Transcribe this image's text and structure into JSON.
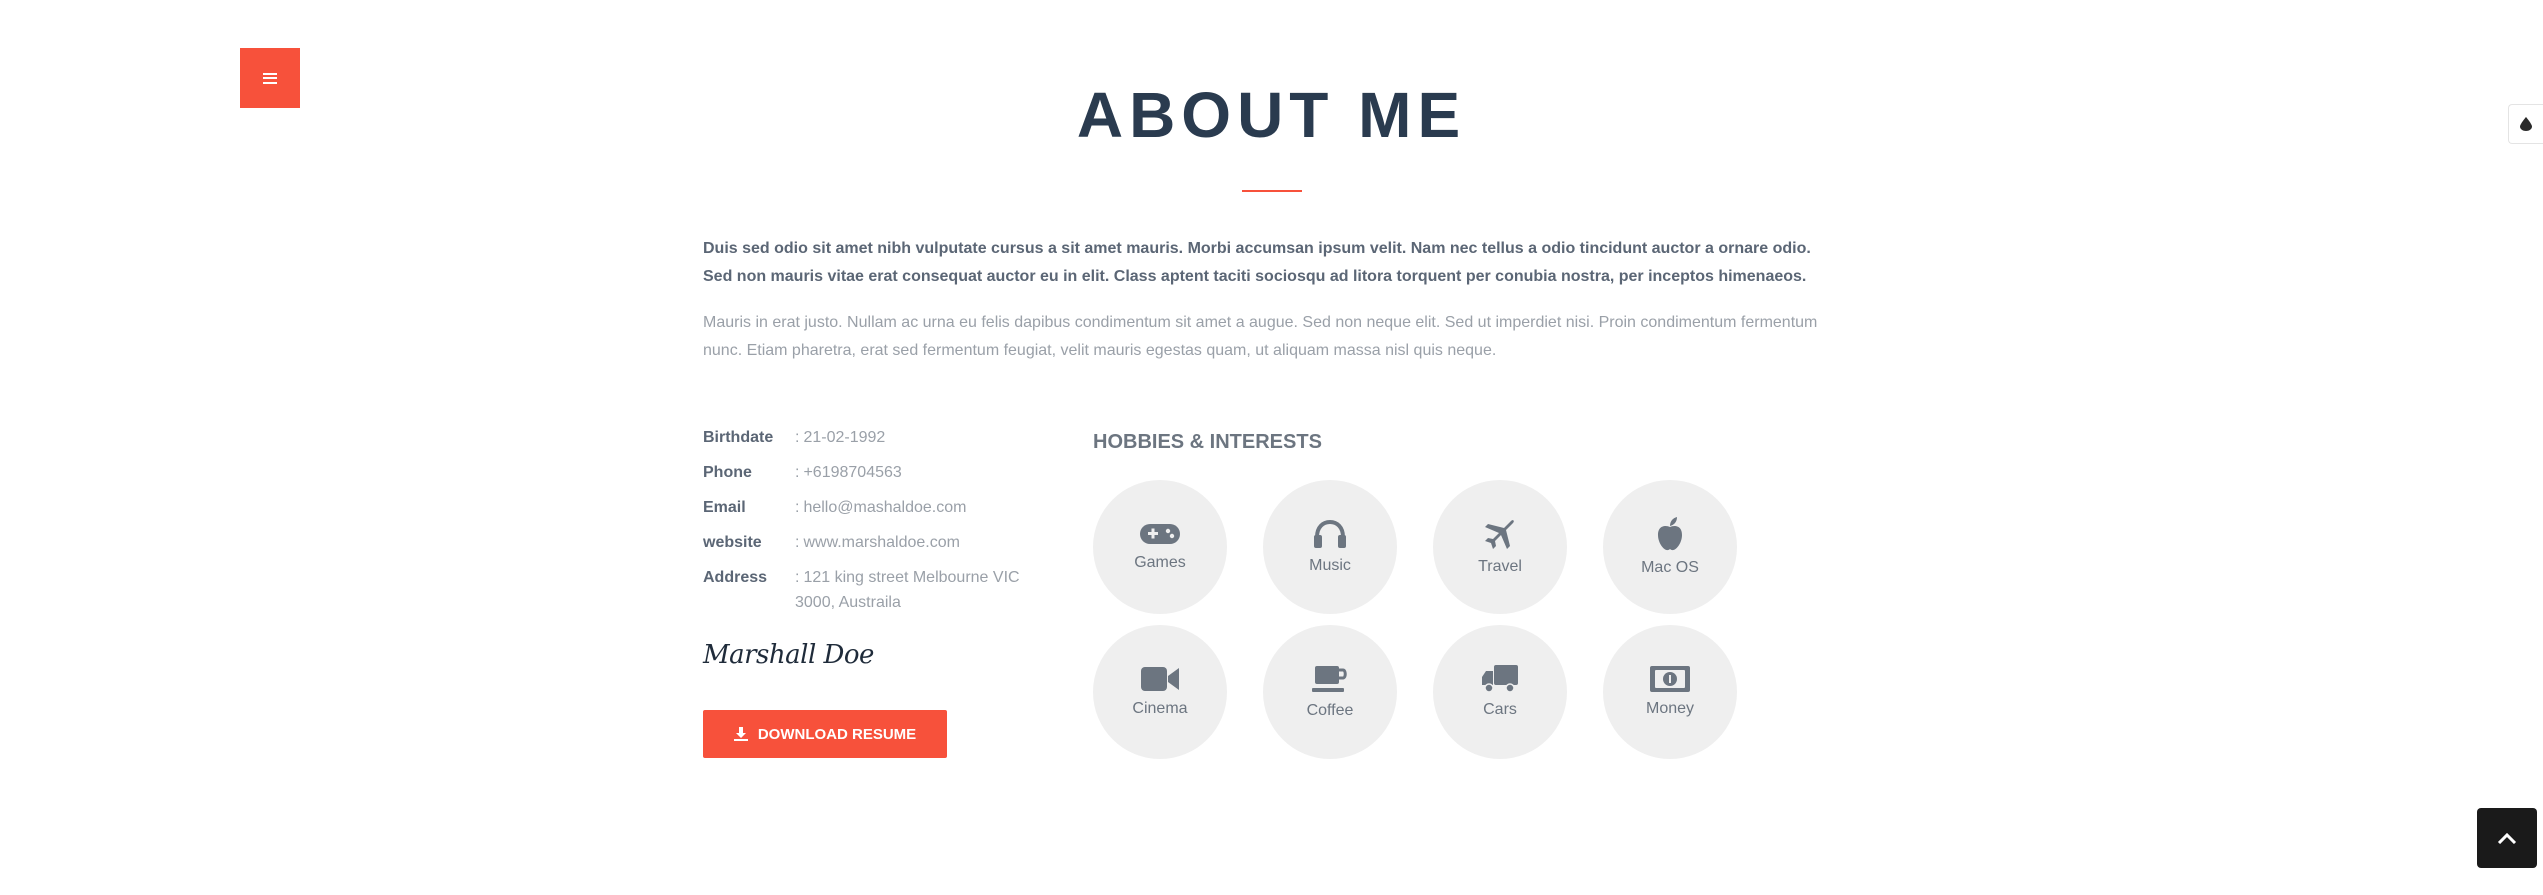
{
  "colors": {
    "accent": "#f7513b",
    "heading": "#2a3b4f",
    "text_bold": "#5b6675",
    "text_muted": "#9aa0a8",
    "circle_bg": "#efefef"
  },
  "header": {
    "menu_icon": "hamburger-icon",
    "theme_icon": "droplet-icon",
    "title": "ABOUT ME"
  },
  "intro": {
    "bold": "Duis sed odio sit amet nibh vulputate cursus a sit amet mauris. Morbi accumsan ipsum velit. Nam nec tellus a odio tincidunt auctor a ornare odio. Sed non mauris vitae erat consequat auctor eu in elit. Class aptent taciti sociosqu ad litora torquent per conubia nostra, per inceptos himenaeos.",
    "light": "Mauris in erat justo. Nullam ac urna eu felis dapibus condimentum sit amet a augue. Sed non neque elit. Sed ut imperdiet nisi. Proin condimentum fermentum nunc. Etiam pharetra, erat sed fermentum feugiat, velit mauris egestas quam, ut aliquam massa nisl quis neque."
  },
  "info": [
    {
      "label": "Birthdate",
      "value": "21-02-1992"
    },
    {
      "label": "Phone",
      "value": "+6198704563"
    },
    {
      "label": "Email",
      "value": "hello@mashaldoe.com"
    },
    {
      "label": "website",
      "value": "www.marshaldoe.com"
    },
    {
      "label": "Address",
      "value": "121 king street Melbourne VIC 3000, Austraila"
    }
  ],
  "signature": "Marshall Doe",
  "download": {
    "label": "DOWNLOAD RESUME",
    "icon": "download-icon"
  },
  "hobbies": {
    "title": "HOBBIES & INTERESTS",
    "items": [
      {
        "label": "Games",
        "icon": "gamepad-icon"
      },
      {
        "label": "Music",
        "icon": "headphones-icon"
      },
      {
        "label": "Travel",
        "icon": "plane-icon"
      },
      {
        "label": "Mac OS",
        "icon": "apple-icon"
      },
      {
        "label": "Cinema",
        "icon": "video-camera-icon"
      },
      {
        "label": "Coffee",
        "icon": "coffee-icon"
      },
      {
        "label": "Cars",
        "icon": "truck-icon"
      },
      {
        "label": "Money",
        "icon": "money-icon"
      }
    ]
  },
  "back_to_top_icon": "chevron-up-icon"
}
